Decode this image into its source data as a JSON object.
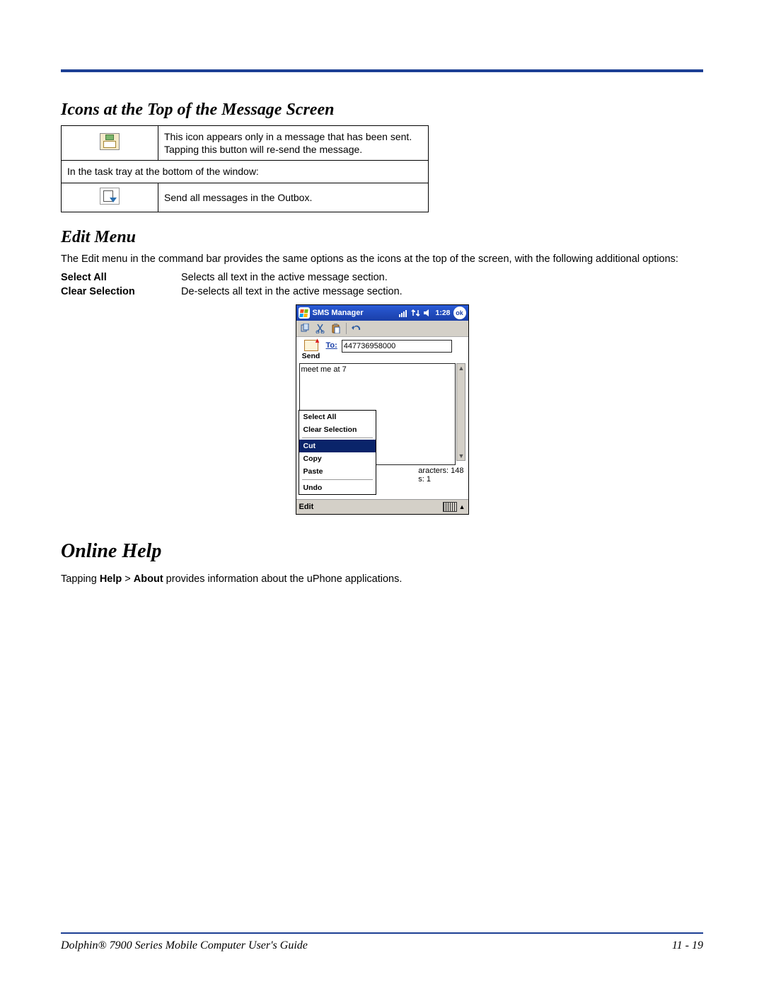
{
  "sections": {
    "icons_heading": "Icons at the Top of the Message Screen",
    "edit_heading": "Edit Menu",
    "help_heading": "Online Help"
  },
  "icons_table": {
    "row1_desc": "This icon appears only in a message that has been sent. Tapping this button will re-send the message.",
    "row2_span": "In the task tray at the bottom of the window:",
    "row3_desc": "Send all messages in the Outbox."
  },
  "edit_intro": "The Edit menu in the command bar provides the same options as the icons at the top of the screen, with the following additional options:",
  "options": {
    "select_all": {
      "label": "Select All",
      "desc": "Selects all text in the active message section."
    },
    "clear_sel": {
      "label": "Clear Selection",
      "desc": "De-selects all text in the active message section."
    }
  },
  "device": {
    "title": "SMS Manager",
    "time": "1:28",
    "ok": "ok",
    "send": "Send",
    "to_label": "To:",
    "to_value": "447736958000",
    "message": "meet me at 7",
    "menu": {
      "select_all": "Select All",
      "clear_selection": "Clear Selection",
      "cut": "Cut",
      "copy": "Copy",
      "paste": "Paste",
      "undo": "Undo"
    },
    "chars": "aracters: 148",
    "msgs": "s: 1",
    "edit": "Edit"
  },
  "help_text_pre": "Tapping ",
  "help_bold1": "Help",
  "help_gt": " > ",
  "help_bold2": "About",
  "help_text_post": " provides information about the uPhone applications.",
  "footer": {
    "left": "Dolphin® 7900 Series Mobile Computer User's Guide",
    "right": "11 - 19"
  }
}
